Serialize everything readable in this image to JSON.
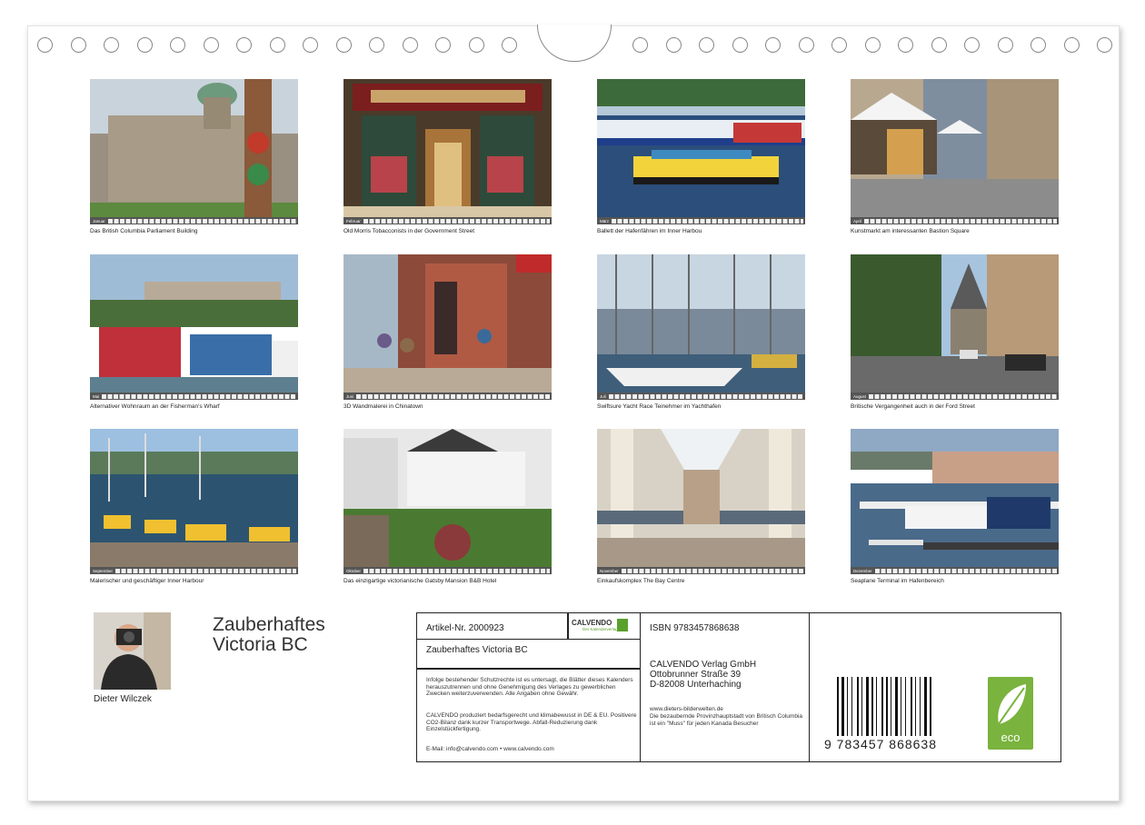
{
  "calendar": {
    "title_line1": "Zauberhaftes",
    "title_line2": "Victoria BC",
    "author": "Dieter Wilczek"
  },
  "months": [
    {
      "month": "Januar",
      "caption": "Das British Columbia Parliament Building"
    },
    {
      "month": "Februar",
      "caption": "Old Morris Tobacconists in der Government Street"
    },
    {
      "month": "März",
      "caption": "Ballett der Hafenfähren im Inner Harbou"
    },
    {
      "month": "April",
      "caption": "Kunstmarkt am interessanten Bastion Square"
    },
    {
      "month": "Mai",
      "caption": "Alternativer Wohnraum an der Fisherman's Wharf"
    },
    {
      "month": "Juni",
      "caption": "3D Wandmalerei in Chinatown"
    },
    {
      "month": "Juli",
      "caption": "Swiftsure Yacht Race Teinehmer im Yachthafen"
    },
    {
      "month": "August",
      "caption": "Britische Vergangenheit auch in der Ford Street"
    },
    {
      "month": "September",
      "caption": "Malerischer und geschäftiger Inner Harbour"
    },
    {
      "month": "Oktober",
      "caption": "Das einzigartige victorianische Gatsby Mansion B&B Hotel"
    },
    {
      "month": "November",
      "caption": "Einkaufskomplex The Bay Centre"
    },
    {
      "month": "Dezember",
      "caption": "Seaplane Terminal im Hafenbereich"
    }
  ],
  "info": {
    "article": "Artikel-Nr. 2000923",
    "logo": "CALVENDO",
    "logo_sub": "Der Kalenderverlag",
    "product_title": "Zauberhaftes Victoria BC",
    "legal": "Infolge bestehender Schutzrechte ist es untersagt, die Blätter dieses Kalenders herauszutrennen und ohne Genehmigung des Verlages zu gewerblichen Zwecken weiterzuverwenden. Alle Angaben ohne Gewähr.",
    "eco_note": "CALVENDO produziert bedarfsgerecht und klimabewusst in DE & EU. Positivere CO2-Bilanz dank kurzer Transportwege. Abfall-Reduzierung dank Einzelstückfertigung.",
    "contact": "E-Mail: info@calvendo.com • www.calvendo.com",
    "isbn": "ISBN 9783457868638",
    "publisher": "CALVENDO Verlag GmbH",
    "street": "Ottobrunner Straße 39",
    "city": "D-82008 Unterhaching",
    "website": "www.dieters-bilderwelten.de",
    "description": "Die bezaubernde Provinzhauptstadt von Britisch Columbia ist ein \"Muss\" für jeden Kanada Besucher",
    "ean": "9 783457 868638",
    "eco_label": "eco"
  },
  "colors": {
    "eco_green": "#7ab33e",
    "calvendo_green": "#5aa02c",
    "frame": "#222222"
  }
}
